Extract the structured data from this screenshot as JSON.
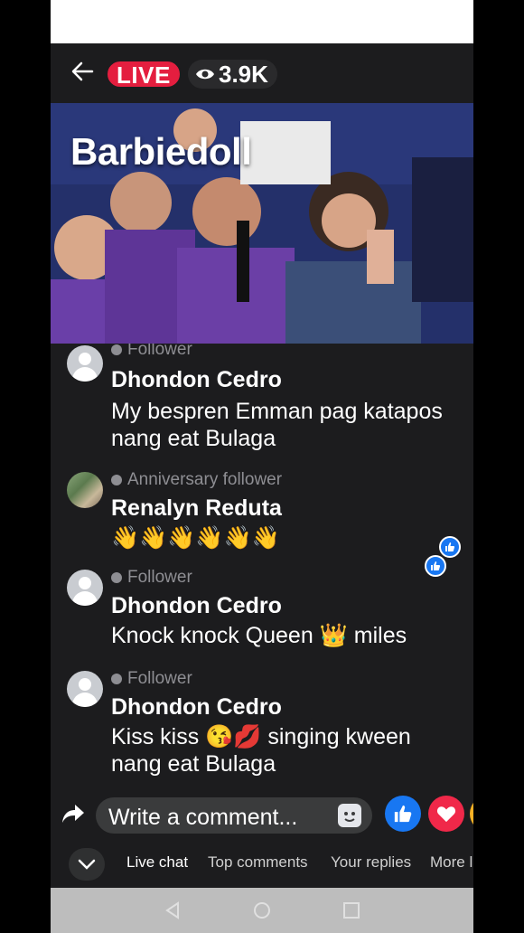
{
  "header": {
    "live_label": "LIVE",
    "viewers": "3.9K"
  },
  "video": {
    "title": "Barbiedoll"
  },
  "comments": [
    {
      "badge": "Follower",
      "name": "Dhondon Cedro",
      "message": "My bespren Emman pag katapos nang eat Bulaga"
    },
    {
      "badge": "Anniversary follower",
      "name": "Renalyn Reduta",
      "message": "👋👋👋👋👋👋"
    },
    {
      "badge": "Follower",
      "name": "Dhondon Cedro",
      "message": "Knock knock Queen 👑 miles"
    },
    {
      "badge": "Follower",
      "name": "Dhondon Cedro",
      "message": "Kiss kiss 😘💋 singing kween nang eat Bulaga"
    }
  ],
  "composer": {
    "placeholder": "Write a comment..."
  },
  "tabs": {
    "live_chat": "Live chat",
    "top_comments": "Top comments",
    "your_replies": "Your replies",
    "more": "More l"
  },
  "colors": {
    "live_red": "#e41e3f",
    "like_blue": "#1877f2",
    "love_red": "#f02849",
    "background": "#1c1c1e"
  }
}
